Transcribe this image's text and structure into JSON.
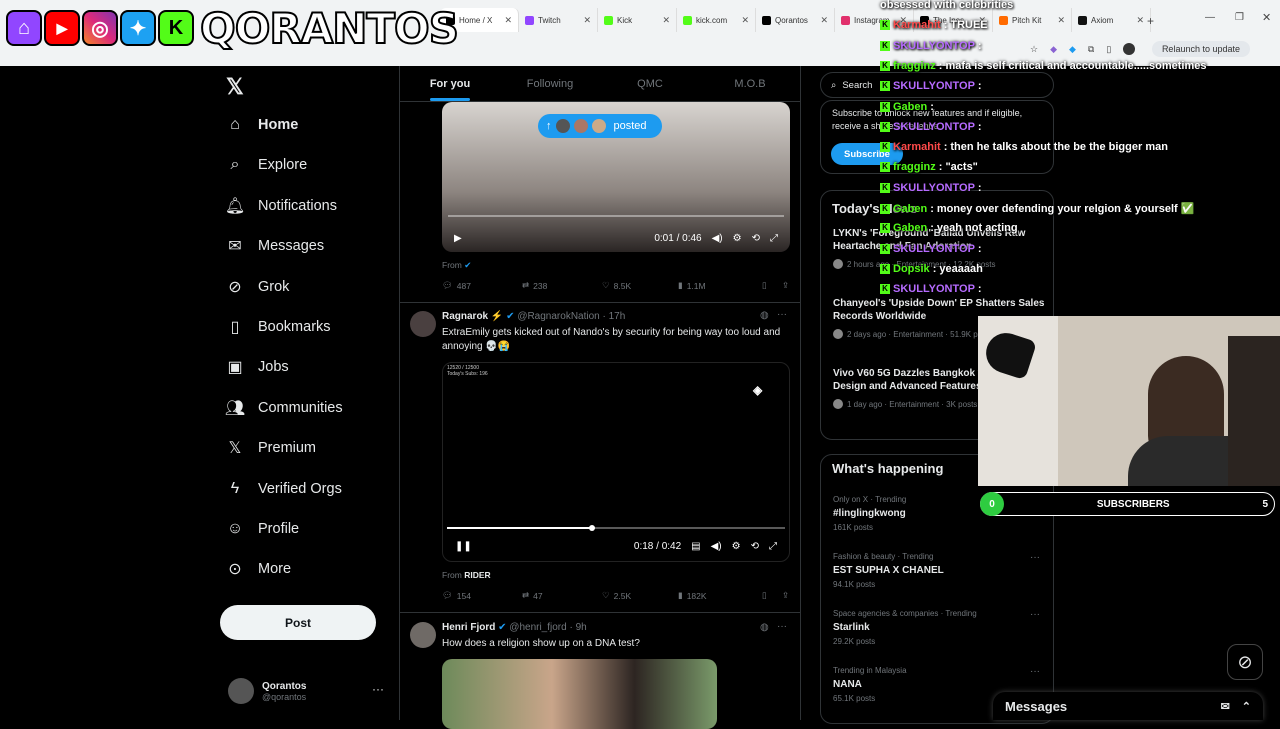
{
  "browser": {
    "tabs": [
      {
        "label": "Home / X",
        "color": "#000000",
        "active": true
      },
      {
        "label": "Twitch",
        "color": "#9146ff"
      },
      {
        "label": "Kick",
        "color": "#53fc18"
      },
      {
        "label": "kick.com",
        "color": "#53fc18"
      },
      {
        "label": "Qorantos",
        "color": "#000000"
      },
      {
        "label": "Instagram",
        "color": "#e1306c"
      },
      {
        "label": "The Ines",
        "color": "#000000"
      },
      {
        "label": "Pitch Kit",
        "color": "#ff6a00"
      },
      {
        "label": "Axiom",
        "color": "#111111"
      }
    ],
    "relaunch_label": "Relaunch to update"
  },
  "brand": {
    "name": "QORANTOS"
  },
  "nav": {
    "items": [
      {
        "label": "Home",
        "icon": "home-icon"
      },
      {
        "label": "Explore",
        "icon": "search-icon"
      },
      {
        "label": "Notifications",
        "icon": "bell-icon"
      },
      {
        "label": "Messages",
        "icon": "envelope-icon"
      },
      {
        "label": "Grok",
        "icon": "grok-icon"
      },
      {
        "label": "Bookmarks",
        "icon": "bookmark-icon"
      },
      {
        "label": "Jobs",
        "icon": "briefcase-icon"
      },
      {
        "label": "Communities",
        "icon": "people-icon"
      },
      {
        "label": "Premium",
        "icon": "x-logo-icon"
      },
      {
        "label": "Verified Orgs",
        "icon": "lightning-icon"
      },
      {
        "label": "Profile",
        "icon": "person-icon"
      },
      {
        "label": "More",
        "icon": "more-circle-icon"
      }
    ],
    "post_label": "Post",
    "account": {
      "name": "Qorantos",
      "handle": "@qorantos"
    }
  },
  "timeline": {
    "tabs": [
      "For you",
      "Following",
      "QMC",
      "M.O.B"
    ],
    "posted_pill": "posted",
    "tweet1": {
      "time": "0:01 / 0:46",
      "from": "From",
      "replies": "487",
      "reposts": "238",
      "likes": "8.5K",
      "views": "1.1M"
    },
    "tweet2": {
      "name": "Ragnarok",
      "handle": "@RagnarokNation · 17h",
      "text": "ExtraEmily gets kicked out of Nando's by security for being way too loud and annoying 💀😭",
      "video_overlay_line1": "12520 / 12500",
      "video_overlay_line2": "Today's Subs: 196",
      "time": "0:18 / 0:42",
      "from_label": "From",
      "from_name": "RIDER",
      "replies": "154",
      "reposts": "47",
      "likes": "2.5K",
      "views": "182K",
      "progress": 0.43
    },
    "tweet3": {
      "name": "Henri Fjord",
      "handle": "@henri_fjord · 9h",
      "text": "How does a religion show up on a DNA test?"
    }
  },
  "right": {
    "search_placeholder": "Search",
    "subscribe_text": "Subscribe to unlock new features and if eligible, receive a share of revenue.",
    "subscribe_button": "Subscribe",
    "news_title": "Today's News",
    "news": [
      {
        "title": "LYKN's 'Foreground' Ballad Unveils Raw Heartache and Fan Adoration",
        "meta": "2 hours ago · Entertainment · 12.2K posts"
      },
      {
        "title": "Chanyeol's 'Upside Down' EP Shatters Sales Records Worldwide",
        "meta": "2 days ago · Entertainment · 51.9K posts"
      },
      {
        "title": "Vivo V60 5G Dazzles Bangkok with Sleek Design and Advanced Features",
        "meta": "1 day ago · Entertainment · 3K posts"
      }
    ],
    "happening_title": "What's happening",
    "trends": [
      {
        "meta": "Only on X · Trending",
        "name": "#linglingkwong",
        "count": "161K posts"
      },
      {
        "meta": "Fashion & beauty · Trending",
        "name": "EST SUPHA X CHANEL",
        "count": "94.1K posts"
      },
      {
        "meta": "Space agencies & companies · Trending",
        "name": "Starlink",
        "count": "29.2K posts"
      },
      {
        "meta": "Trending in Malaysia",
        "name": "NANA",
        "count": "65.1K posts"
      }
    ]
  },
  "chat": [
    {
      "user": "",
      "msg": "obsessed with celebrities",
      "color": "#ffffff"
    },
    {
      "user": "Karmahit",
      "msg": "TRUEE",
      "color": "#ff4a4a"
    },
    {
      "user": "SKULLYONTOP",
      "msg": "",
      "color": "#b66bff"
    },
    {
      "user": "fragginz",
      "msg": "mafa is self critical and accountable.....sometimes",
      "color": "#53fc18"
    },
    {
      "user": "SKULLYONTOP",
      "msg": "",
      "color": "#b66bff"
    },
    {
      "user": "Gaben",
      "msg": "",
      "color": "#53fc18"
    },
    {
      "user": "SKULLYONTOP",
      "msg": "",
      "color": "#b66bff"
    },
    {
      "user": "Karmahit",
      "msg": "then he talks about the be the bigger man",
      "color": "#ff4a4a"
    },
    {
      "user": "fragginz",
      "msg": "\"acts\"",
      "color": "#53fc18"
    },
    {
      "user": "SKULLYONTOP",
      "msg": "",
      "color": "#b66bff"
    },
    {
      "user": "Gaben",
      "msg": "money over defending your relgion & yourself ✅",
      "color": "#53fc18"
    },
    {
      "user": "Gaben",
      "msg": "yeah not acting",
      "color": "#53fc18"
    },
    {
      "user": "SKULLYONTOP",
      "msg": "",
      "color": "#b66bff"
    },
    {
      "user": "Dopsik",
      "msg": "yeaaaah",
      "color": "#53fc18"
    },
    {
      "user": "SKULLYONTOP",
      "msg": "",
      "color": "#b66bff"
    }
  ],
  "subs": {
    "left": "0",
    "label": "SUBSCRIBERS",
    "right": "5",
    "progress": 0
  },
  "messages_label": "Messages"
}
